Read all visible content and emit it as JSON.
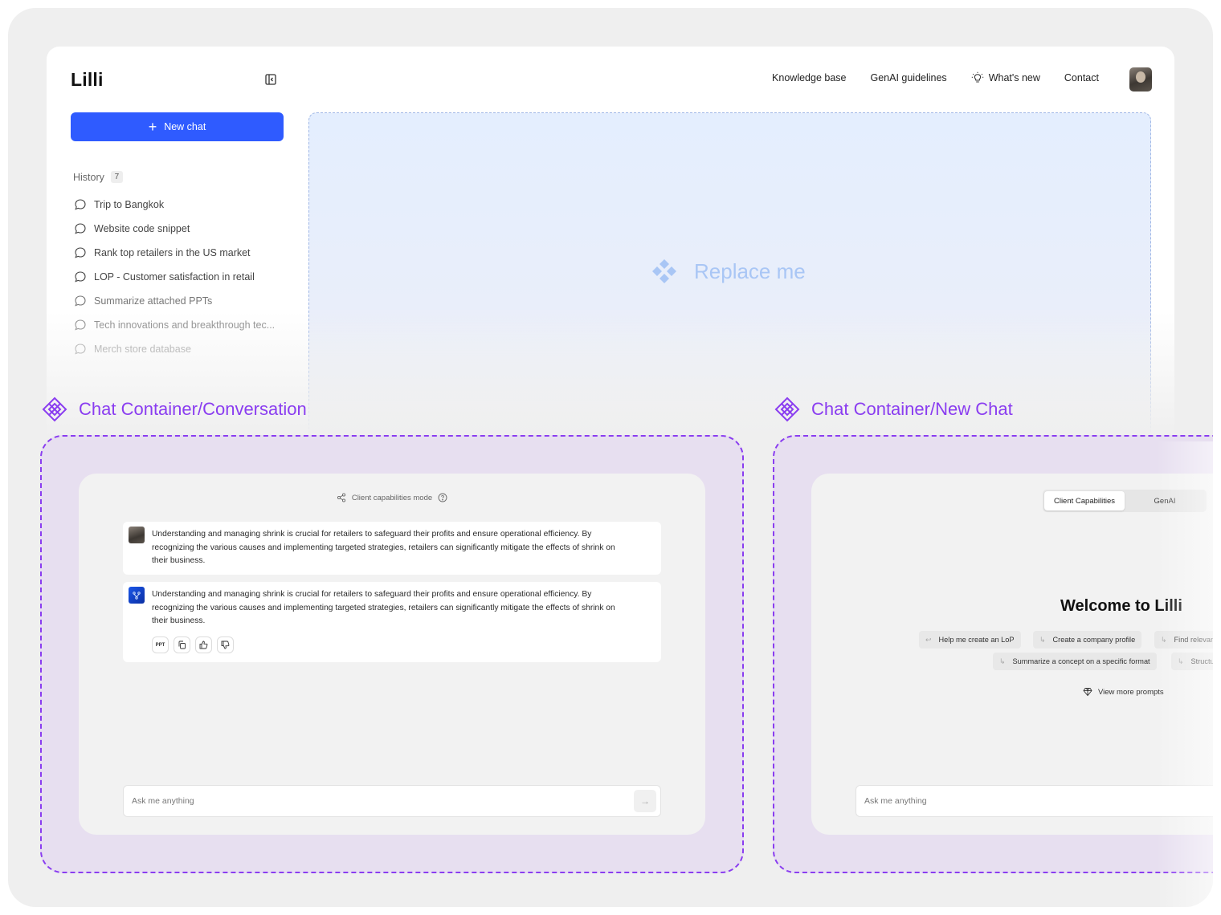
{
  "app": {
    "logo": "Lilli",
    "nav": {
      "knowledge_base": "Knowledge base",
      "genai_guidelines": "GenAI guidelines",
      "whats_new": "What's new",
      "contact": "Contact"
    },
    "new_chat_label": "New chat",
    "history": {
      "title": "History",
      "count": "7",
      "items": [
        {
          "label": "Trip to Bangkok"
        },
        {
          "label": "Website code snippet"
        },
        {
          "label": "Rank top retailers in the US market"
        },
        {
          "label": "LOP - Customer satisfaction in retail"
        },
        {
          "label": "Summarize attached PPTs"
        },
        {
          "label": "Tech innovations and breakthrough tec..."
        },
        {
          "label": "Merch store database"
        }
      ]
    },
    "placeholder_label": "Replace me"
  },
  "components": {
    "conversation": {
      "title": "Chat Container/Conversation",
      "mode_label": "Client capabilities mode",
      "user_message": "Understanding and managing shrink is crucial for retailers to safeguard their profits and ensure operational efficiency. By recognizing the various causes and implementing targeted strategies, retailers can significantly mitigate the effects of shrink on their business.",
      "ai_message": "Understanding and managing shrink is crucial for retailers to safeguard their profits and ensure operational efficiency. By recognizing the various causes and implementing targeted strategies, retailers can significantly mitigate the effects of shrink on their business.",
      "ppt_label": "PPT",
      "input_placeholder": "Ask me anything"
    },
    "new_chat": {
      "title": "Chat Container/New Chat",
      "tabs": [
        "Client Capabilities",
        "GenAI"
      ],
      "welcome": "Welcome to Lilli",
      "prompts_row1": [
        "Help me create an LoP",
        "Create a company profile",
        "Find relevant"
      ],
      "prompts_row2": [
        "Summarize a concept on a specific format",
        "Structu"
      ],
      "view_more": "View more prompts",
      "input_placeholder": "Ask me anything"
    }
  },
  "colors": {
    "accent_blue": "#2f5bff",
    "component_purple": "#8a3df0",
    "component_bg": "#e7dff0",
    "placeholder_blue": "#a9c6f5"
  },
  "icons": [
    "sidebar-collapse-icon",
    "lightbulb-icon",
    "plus-icon",
    "chat-bubble-icon",
    "component-diamond-icon",
    "share-icon",
    "help-circle-icon",
    "copy-icon",
    "thumbs-up-icon",
    "thumbs-down-icon",
    "arrow-right-icon",
    "gem-icon",
    "return-arrow-icon"
  ]
}
